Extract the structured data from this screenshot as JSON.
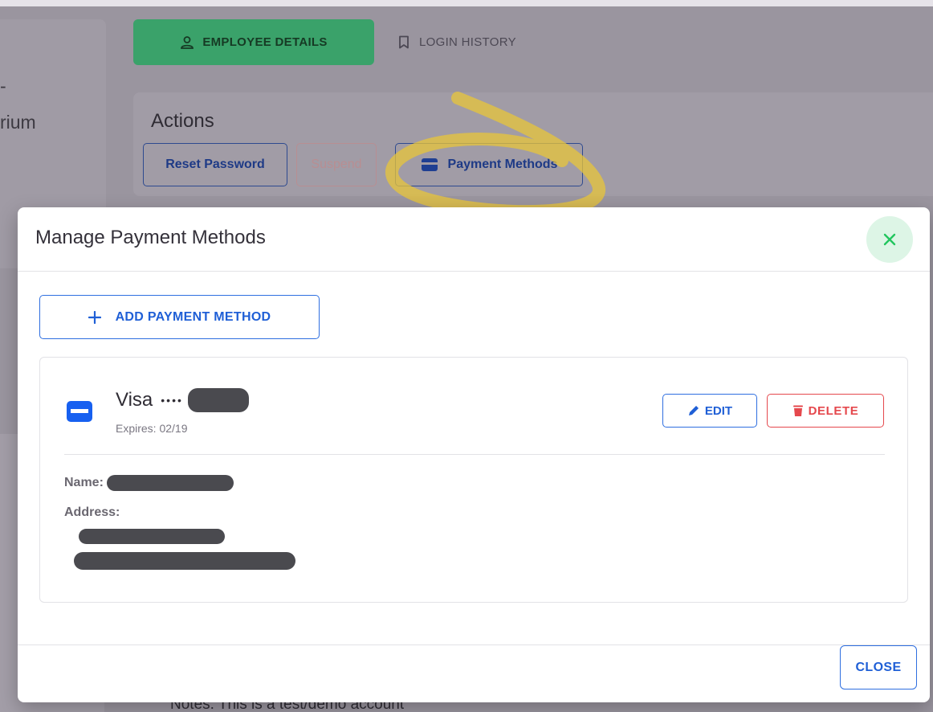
{
  "background": {
    "left_fragments": [
      "-",
      "rium"
    ],
    "tabs": {
      "employee_details": "EMPLOYEE DETAILS",
      "login_history": "LOGIN HISTORY"
    },
    "actions": {
      "title": "Actions",
      "reset_password": "Reset Password",
      "suspend": "Suspend",
      "payment_methods": "Payment Methods"
    },
    "notes": "Notes:  This is a test/demo account"
  },
  "modal": {
    "title": "Manage Payment Methods",
    "add_button": "ADD PAYMENT METHOD",
    "card": {
      "brand": "Visa",
      "masked_dots": "••••",
      "expires": "Expires: 02/19",
      "edit_label": "EDIT",
      "delete_label": "DELETE",
      "name_label": "Name:",
      "address_label": "Address:"
    },
    "close_button": "CLOSE"
  },
  "colors": {
    "primary": "#1f5fd6",
    "danger": "#e5484d",
    "success": "#3aa26a",
    "close_x": "#22c55e",
    "highlight": "#e8c53a"
  },
  "icons": {
    "employee_tab": "person-icon",
    "login_tab": "bookmark-icon",
    "payment_action": "credit-card-icon",
    "modal_close": "close-icon",
    "add": "plus-icon",
    "card": "credit-card-icon",
    "edit": "pencil-icon",
    "delete": "trash-icon"
  }
}
